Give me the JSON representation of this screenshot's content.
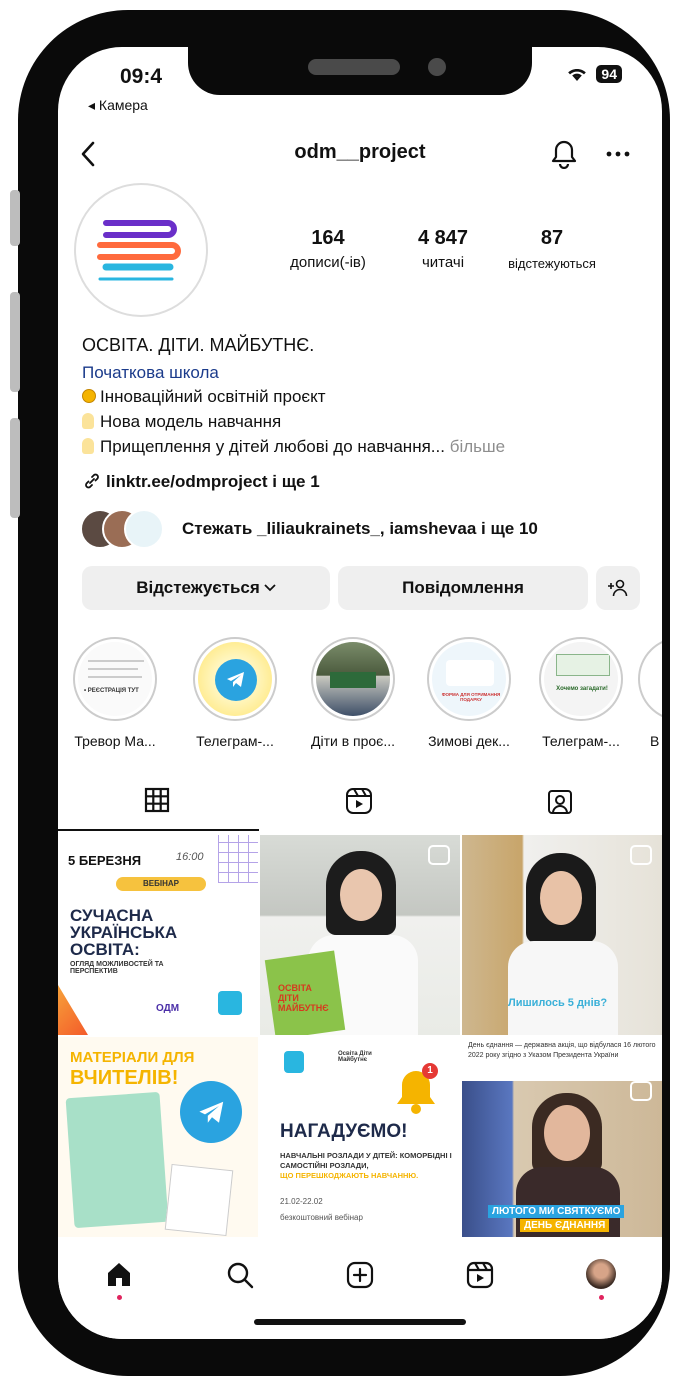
{
  "status_bar": {
    "time": "09:4",
    "back_app": "◂ Камера",
    "battery": "94"
  },
  "header": {
    "username": "odm__project"
  },
  "stats": [
    {
      "value": "164",
      "label": "дописи(-ів)"
    },
    {
      "value": "4 847",
      "label": "читачі"
    },
    {
      "value": "87",
      "label": "відстежуються"
    }
  ],
  "bio": {
    "name": "ОСВІТА. ДІТИ. МАЙБУТНЄ.",
    "category": "Початкова школа",
    "lines": [
      "Інноваційний освітній проєкт",
      "Нова модель навчання",
      "Прищеплення у дітей любові до навчання..."
    ],
    "more": "більше",
    "link": "linktr.ee/odmproject і ще 1",
    "followed_by": "Стежать _liliaukrainets_, iamshevaa і ще 10"
  },
  "buttons": {
    "following": "Відстежується",
    "message": "Повідомлення"
  },
  "highlights": [
    {
      "label": "Тревор Ма...",
      "inner": "• РЕЄСТРАЦІЯ ТУТ"
    },
    {
      "label": "Телеграм-..."
    },
    {
      "label": "Діти в проє..."
    },
    {
      "label": "Зимові дек...",
      "inner": "ФОРМА ДЛЯ ОТРИМАННЯ ПОДАРКУ"
    },
    {
      "label": "Телеграм-...",
      "inner": "Хочемо загадати!"
    },
    {
      "label": "В"
    }
  ],
  "posts": {
    "p1": {
      "date": "5 БЕРЕЗНЯ",
      "time": "16:00",
      "badge": "ВЕБІНАР",
      "title": "СУЧАСНА УКРАЇНСЬКА ОСВІТА:",
      "subtitle": "ОГЛЯД МОЖЛИВОСТЕЙ ТА ПЕРСПЕКТИВ",
      "logo": "ОДМ"
    },
    "p2": {
      "book_text": "ОСВІТА ДІТИ МАЙБУТНЄ"
    },
    "p3": {
      "caption": "Лишилось 5 днів?"
    },
    "p4": {
      "title1": "МАТЕРІАЛИ ДЛЯ",
      "title2": "ВЧИТЕЛІВ!"
    },
    "p5": {
      "brand": "Освіта Діти Майбутнє",
      "title": "НАГАДУЄМО!",
      "subtitle1": "НАВЧАЛЬНІ РОЗЛАДИ У ДІТЕЙ: КОМОРБІДНІ І САМОСТІЙНІ РОЗЛАДИ,",
      "subtitle2": "ЩО ПЕРЕШКОДЖАЮТЬ НАВЧАННЮ.",
      "date": "21.02-22.02",
      "type": "безкоштовний вебінар",
      "count": "1"
    },
    "p6": {
      "top_text": "День єднання — державна акція, що відбулася 16 лютого 2022 року згідно з Указом Президента України",
      "caption1": "ЛЮТОГО МИ СВЯТКУЄМО",
      "caption2": "ДЕНЬ ЄДНАННЯ"
    }
  },
  "colors": {
    "link_blue": "#1b3b8b",
    "accent_yellow": "#f5b400",
    "notification_red": "#e0245e"
  }
}
